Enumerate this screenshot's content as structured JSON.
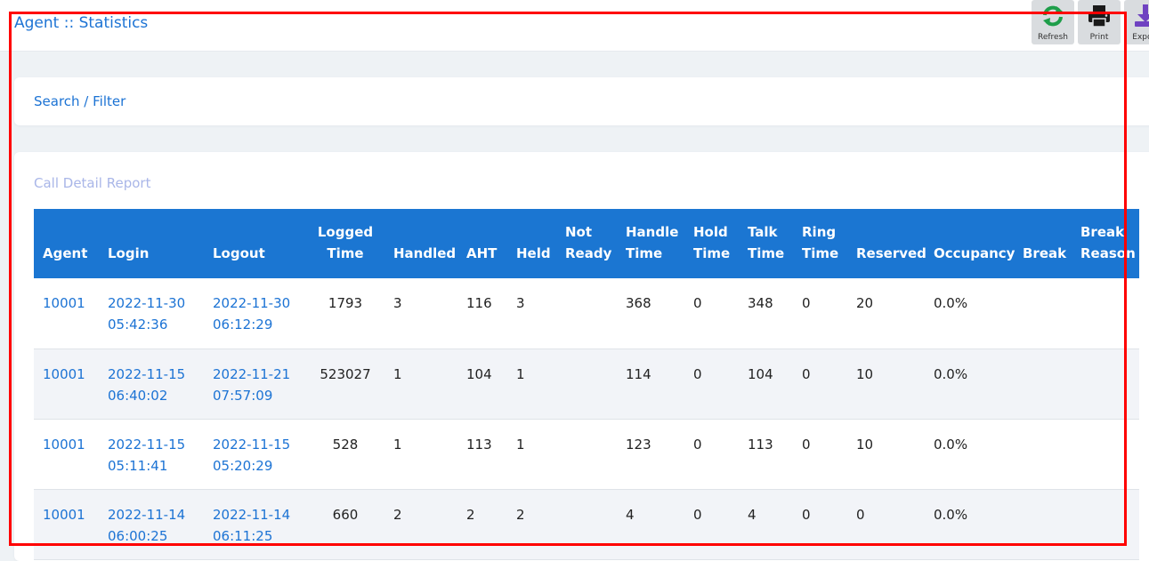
{
  "header": {
    "title": "Agent :: Statistics"
  },
  "toolbar": {
    "refresh_label": "Refresh",
    "print_label": "Print",
    "export_label": "Export",
    "colors": {
      "refresh": "#1e9e4a",
      "print": "#1a1a1a",
      "export": "#6f42c1"
    }
  },
  "filter": {
    "label": "Search / Filter"
  },
  "report": {
    "title": "Call Detail Report",
    "columns": [
      "Agent",
      "Login",
      "Logout",
      "Logged Time",
      "Handled",
      "AHT",
      "Held",
      "Not Ready",
      "Handle Time",
      "Hold Time",
      "Talk Time",
      "Ring Time",
      "Reserved",
      "Occupancy",
      "Break",
      "Break Reason"
    ],
    "rows": [
      [
        "10001",
        "2022-11-30 05:42:36",
        "2022-11-30 06:12:29",
        "1793",
        "3",
        "116",
        "3",
        "",
        "368",
        "0",
        "348",
        "0",
        "20",
        "0.0%",
        "",
        ""
      ],
      [
        "10001",
        "2022-11-15 06:40:02",
        "2022-11-21 07:57:09",
        "523027",
        "1",
        "104",
        "1",
        "",
        "114",
        "0",
        "104",
        "0",
        "10",
        "0.0%",
        "",
        ""
      ],
      [
        "10001",
        "2022-11-15 05:11:41",
        "2022-11-15 05:20:29",
        "528",
        "1",
        "113",
        "1",
        "",
        "123",
        "0",
        "113",
        "0",
        "10",
        "0.0%",
        "",
        ""
      ],
      [
        "10001",
        "2022-11-14 06:00:25",
        "2022-11-14 06:11:25",
        "660",
        "2",
        "2",
        "2",
        "",
        "4",
        "0",
        "4",
        "0",
        "0",
        "0.0%",
        "",
        ""
      ]
    ]
  },
  "colors": {
    "accent": "#1c73d4",
    "table_header": "#1b76d2"
  }
}
